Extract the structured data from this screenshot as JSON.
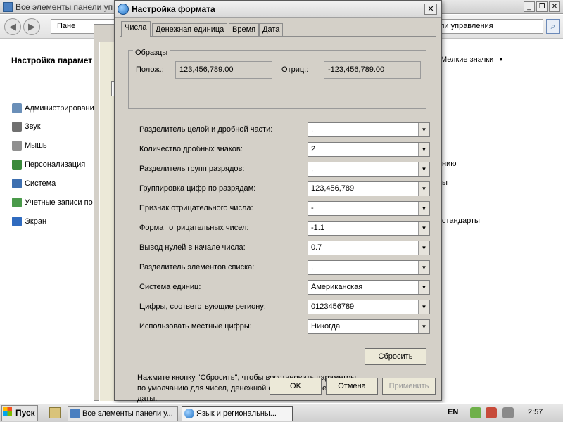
{
  "cp": {
    "title": "Все элементы панели уп",
    "address_left": "Пане",
    "address_right": "ли управления",
    "heading": "Настройка парамет",
    "view_by": "Мелкие значки",
    "items": [
      {
        "label": "Администрировани",
        "color": "#6a8fb8"
      },
      {
        "label": "Звук",
        "color": "#707070"
      },
      {
        "label": "Мышь",
        "color": "#909090"
      },
      {
        "label": "Персонализация",
        "color": "#3a8a3a"
      },
      {
        "label": "Система",
        "color": "#3d6fb0"
      },
      {
        "label": "Учетные записи по",
        "color": "#4a9a4a"
      },
      {
        "label": "Экран",
        "color": "#2f6bbf"
      }
    ],
    "right_items": [
      "нию",
      "ы",
      "стандарты"
    ]
  },
  "dialog": {
    "title": "Настройка формата",
    "close": "✕",
    "tabs": [
      "Числа",
      "Денежная единица",
      "Время",
      "Дата"
    ],
    "samples": {
      "legend": "Образцы",
      "positive_label": "Полож.:",
      "positive_value": "123,456,789.00",
      "negative_label": "Отриц.:",
      "negative_value": "-123,456,789.00"
    },
    "rows": [
      {
        "label": "Разделитель целой и дробной части:",
        "value": "."
      },
      {
        "label": "Количество дробных знаков:",
        "value": "2"
      },
      {
        "label": "Разделитель групп разрядов:",
        "value": ","
      },
      {
        "label": "Группировка цифр по разрядам:",
        "value": "123,456,789"
      },
      {
        "label": "Признак отрицательного числа:",
        "value": "-"
      },
      {
        "label": "Формат отрицательных чисел:",
        "value": "-1.1"
      },
      {
        "label": "Вывод нулей в начале числа:",
        "value": "0.7"
      },
      {
        "label": "Разделитель элементов списка:",
        "value": ","
      },
      {
        "label": "Система единиц:",
        "value": "Американская"
      },
      {
        "label": "Цифры, соответствующие региону:",
        "value": "0123456789"
      },
      {
        "label": "Использовать местные цифры:",
        "value": "Никогда"
      }
    ],
    "reset_text": "Нажмите кнопку \"Сбросить\", чтобы восстановить параметры по умолчанию для чисел, денежной единицы, времени и даты.",
    "reset_button": "Сбросить",
    "ok": "OK",
    "cancel": "Отмена",
    "apply": "Применить"
  },
  "taskbar": {
    "start": "Пуск",
    "tasks": [
      {
        "label": "Все элементы панели у...",
        "active": false
      },
      {
        "label": "Язык и региональны...",
        "active": true
      }
    ],
    "language": "EN",
    "time": "2:57"
  }
}
